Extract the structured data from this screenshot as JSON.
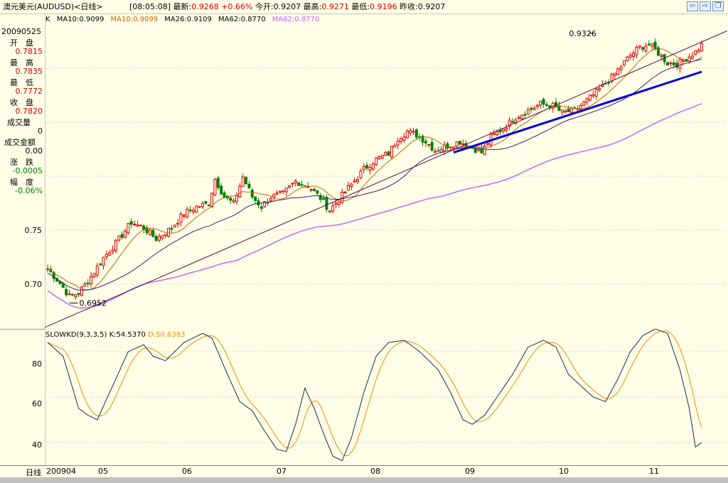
{
  "title": {
    "symbol": "澳元美元(AUDUSD)<日线>",
    "time": "[08:05:08]",
    "latest_label": "最新:",
    "latest_value": "0.9268",
    "change_pct": "+0.66%",
    "open_label": "今开:",
    "open_value": "0.9207",
    "high_label": "最高:",
    "high_value": "0.9271",
    "low_label": "最低:",
    "low_value": "0.9196",
    "prev_label": "昨收:",
    "prev_value": "0.9207"
  },
  "ma_bar": {
    "k": "K",
    "ma10a": "MA10:0.9099",
    "ma10b": "MA10:0.9099",
    "ma26": "MA26:0.9109",
    "ma62a": "MA62:0.8770",
    "ma62b": "MA62:0.8770"
  },
  "left_panel": {
    "date": "20090525",
    "open_label": "开　盘",
    "open_value": "0.7815",
    "high_label": "最　高",
    "high_value": "0.7835",
    "low_label": "最　低",
    "low_value": "0.7772",
    "close_label": "收　盘",
    "close_value": "0.7820",
    "vol_label": "成交量",
    "vol_value": "0",
    "amount_label": "成交金额",
    "amount_value": "0.00",
    "chg_label": "涨　跌",
    "chg_value": "-0.0005",
    "pct_label": "幅　度",
    "pct_value": "-0.06%"
  },
  "price_axis": [
    "0.75",
    "0.70"
  ],
  "annotations": {
    "high_mark": "0.9326",
    "low_mark": "0.6952"
  },
  "kd": {
    "title": "SLOWKD(9,3,3,5)",
    "k_label": "K:54.5370",
    "d_label": "D:50.6383",
    "axis": [
      "80",
      "60",
      "40"
    ]
  },
  "xaxis": {
    "period": "日线",
    "labels": [
      "200904",
      "05",
      "06",
      "07",
      "08",
      "09",
      "10",
      "11"
    ]
  },
  "colors": {
    "up": "#e00000",
    "down": "#008000",
    "ma10": "#c86400",
    "ma26": "#3c1e78",
    "ma62": "#c864ff",
    "trend": "#0000e0",
    "k_line": "#1e2850",
    "d_line": "#f08c00"
  },
  "chart_data": {
    "type": "candlestick",
    "x_range": [
      "200904",
      "11"
    ],
    "ylim": [
      0.67,
      0.955
    ],
    "high": 0.9326,
    "low": 0.6952,
    "indicator": {
      "name": "SLOWKD(9,3,3,5)",
      "K": 54.537,
      "D": 50.6383,
      "ylim": [
        30,
        90
      ]
    }
  }
}
